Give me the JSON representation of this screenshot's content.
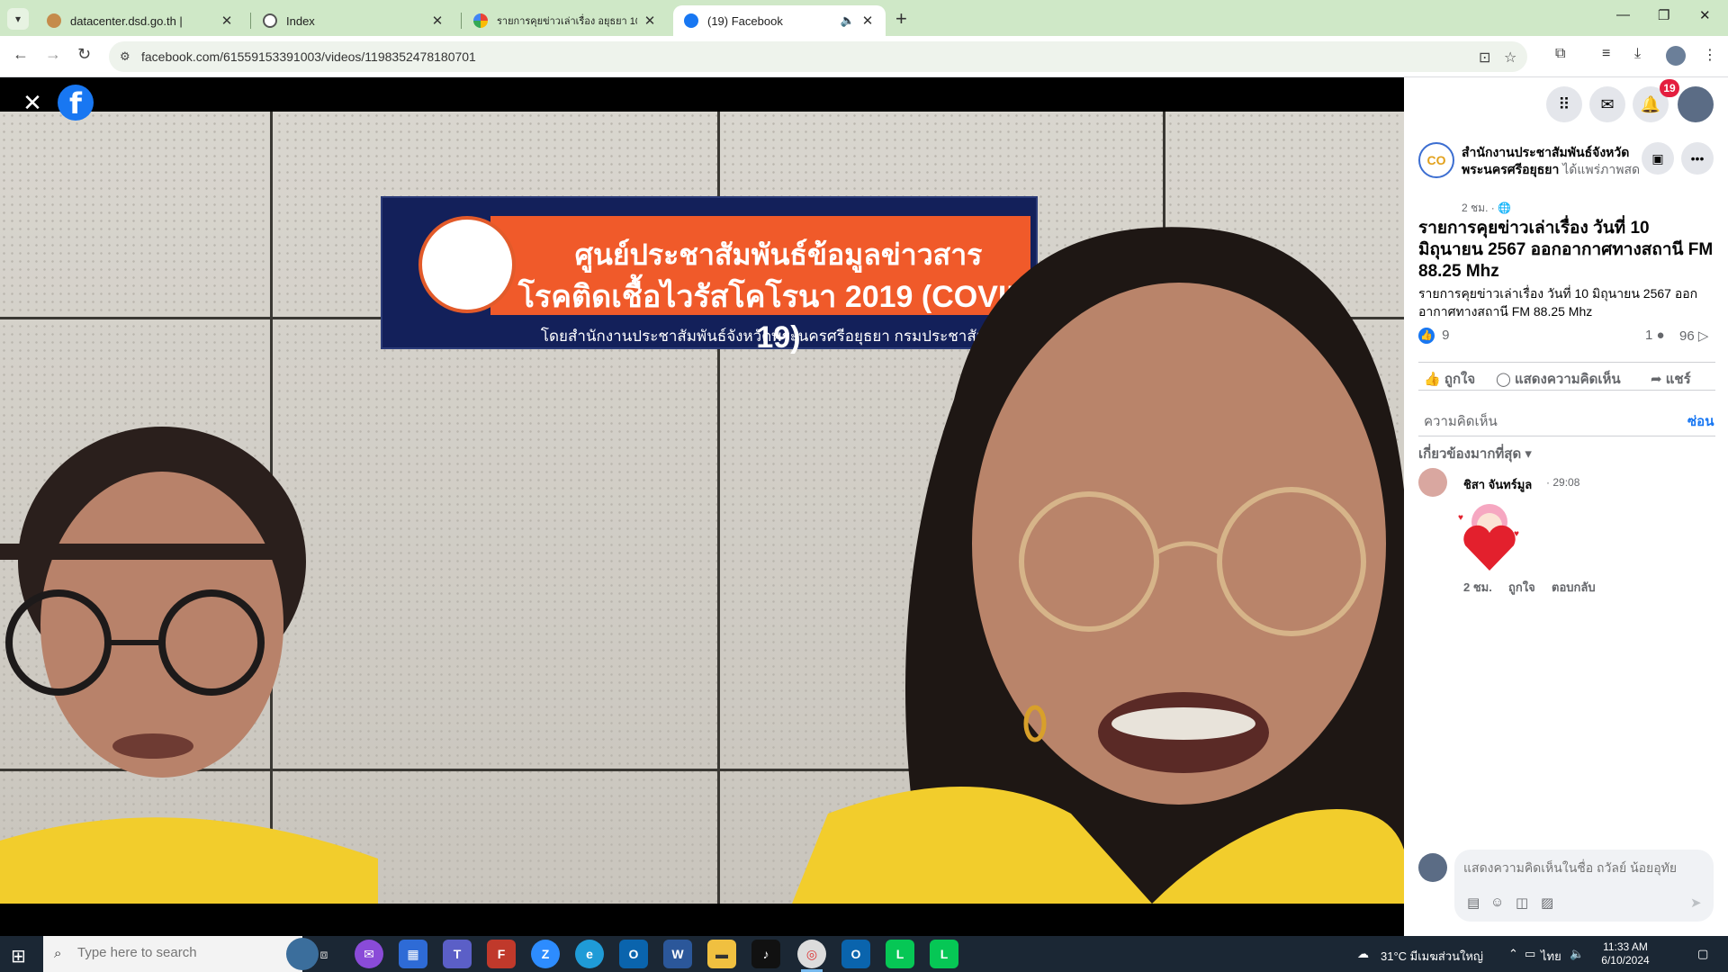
{
  "browser": {
    "tabs": [
      {
        "title": "datacenter.dsd.go.th |",
        "active": false
      },
      {
        "title": "Index",
        "active": false
      },
      {
        "title": "รายการคุยข่าวเล่าเรื่อง อยุธยา 10 มิ...",
        "active": false
      },
      {
        "title": "(19) Facebook",
        "active": true
      }
    ],
    "url": "facebook.com/61559153391003/videos/1198352478180701"
  },
  "video": {
    "banner_line1": "ศูนย์ประชาสัมพันธ์ข้อมูลข่าวสาร",
    "banner_line2": "โรคติดเชื้อไวรัสโคโรนา 2019 (COVID-19)",
    "banner_line3": "โดยสำนักงานประชาสัมพันธ์จังหวัดพระนครศรีอยุธยา กรมประชาสัมพันธ์"
  },
  "facebook": {
    "notification_count": "19",
    "page_name": "สำนักงานประชาสัมพันธ์จังหวัดพระนครศรีอยุธยา",
    "shared_suffix": "ได้แพร่ภาพสด",
    "post_time": "2 ชม. · 🌐",
    "post_title": "รายการคุยข่าวเล่าเรื่อง วันที่ 10 มิถุนายน 2567 ออกอากาศทางสถานี FM 88.25 Mhz",
    "post_desc": "รายการคุยข่าวเล่าเรื่อง วันที่ 10 มิถุนายน 2567 ออกอากาศทางสถานี FM 88.25 Mhz",
    "reactions": "9",
    "comments_count": "1",
    "views_count": "96",
    "like_label": "ถูกใจ",
    "comment_label": "แสดงความคิดเห็น",
    "share_label": "แชร์",
    "comments_header": "ความคิดเห็น",
    "hide_label": "ซ่อน",
    "sort_label": "เกี่ยวข้องมากที่สุด",
    "comment": {
      "author": "ชิสา จันทร์มูล",
      "timestamp": "29:08",
      "age": "2 ชม.",
      "like": "ถูกใจ",
      "reply": "ตอบกลับ"
    },
    "compose_placeholder": "แสดงความคิดเห็นในชื่อ ถวัลย์ น้อยอุทัย"
  },
  "taskbar": {
    "search_placeholder": "Type here to search",
    "weather": "31°C  มีเมฆส่วนใหญ่",
    "language": "ไทย",
    "time": "11:33 AM",
    "date": "6/10/2024"
  },
  "colors": {
    "facebook_blue": "#1877f2",
    "notification_red": "#e41e3f",
    "tabstrip_green": "#cfe8c7",
    "banner_orange": "#f05a2a",
    "banner_navy": "#13205a"
  }
}
